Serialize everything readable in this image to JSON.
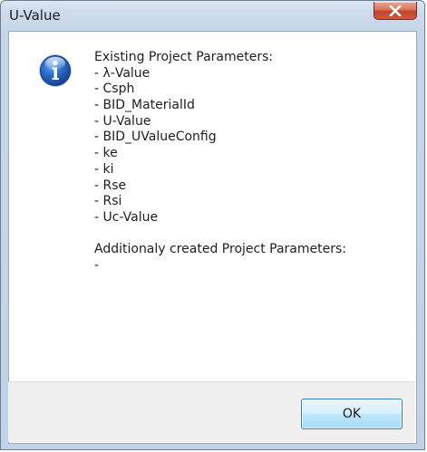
{
  "window": {
    "title": "U-Value"
  },
  "titlebar": {
    "close_icon": "close-x-icon"
  },
  "message": {
    "icon": "info-icon",
    "existing_header": "Existing Project Parameters:",
    "existing_items": [
      " - λ-Value",
      " - Csph",
      " - BID_MaterialId",
      " - U-Value",
      " - BID_UValueConfig",
      " - ke",
      " - ki",
      " - Rse",
      " - Rsi",
      " - Uc-Value"
    ],
    "created_header": "Additionaly created Project Parameters:",
    "created_items": [
      " -"
    ]
  },
  "buttons": {
    "ok_label": "OK"
  },
  "colors": {
    "info_icon_blue": "#1f5fb8",
    "close_button_red": "#c7452c",
    "footer_background": "#f0f0f0",
    "ok_button_border": "#3c7fb1"
  }
}
